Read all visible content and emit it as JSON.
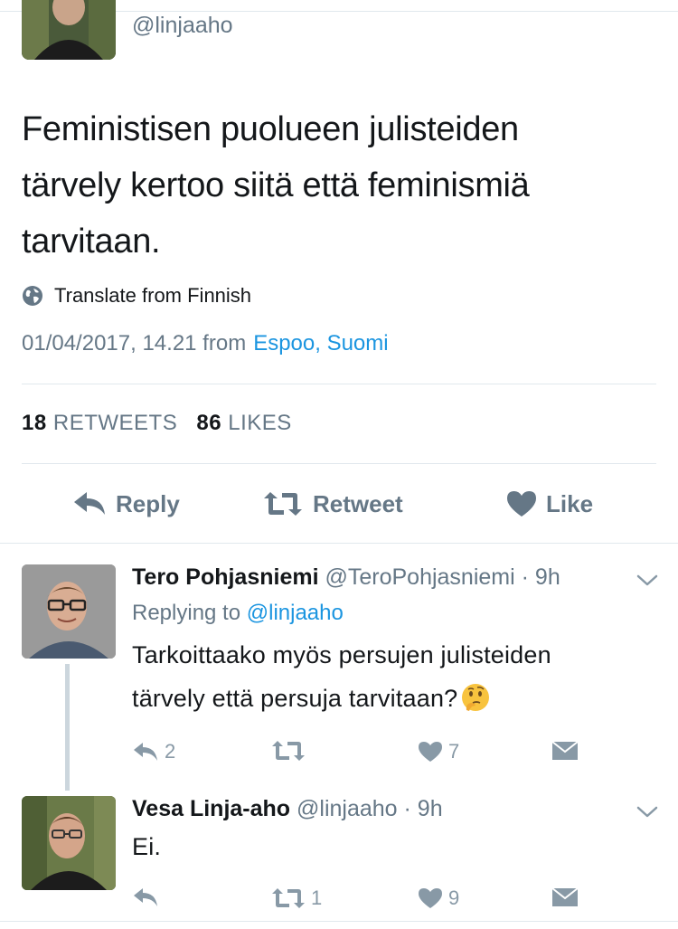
{
  "main_tweet": {
    "handle": "@linjaaho",
    "text_lines": [
      "Feministisen puolueen julisteiden",
      "tärvely kertoo siitä että feminismiä",
      "tarvitaan."
    ],
    "translate_label": "Translate from Finnish",
    "timestamp": "01/04/2017, 14.21 from",
    "location": "Espoo, Suomi",
    "retweets_count": "18",
    "retweets_label": "RETWEETS",
    "likes_count": "86",
    "likes_label": "LIKES",
    "reply_label": "Reply",
    "retweet_label": "Retweet",
    "like_label": "Like"
  },
  "replies": [
    {
      "name": "Tero Pohjasniemi",
      "handle": "@TeroPohjasniemi",
      "time": "· 9h",
      "replying_prefix": "Replying to",
      "replying_to": "@linjaaho",
      "text_lines": [
        "Tarkoittaako myös persujen julisteiden",
        "tärvely että persuja tarvitaan?"
      ],
      "emoji": "thinking-face",
      "reply_count": "2",
      "retweet_count": "",
      "like_count": "7"
    },
    {
      "name": "Vesa Linja-aho",
      "handle": "@linjaaho",
      "time": "· 9h",
      "text_lines": [
        "Ei."
      ],
      "reply_count": "",
      "retweet_count": "1",
      "like_count": "9"
    }
  ],
  "colors": {
    "link": "#1b95e0",
    "secondary": "#657786",
    "icon": "#8899a6",
    "divider": "#e1e8ed"
  }
}
